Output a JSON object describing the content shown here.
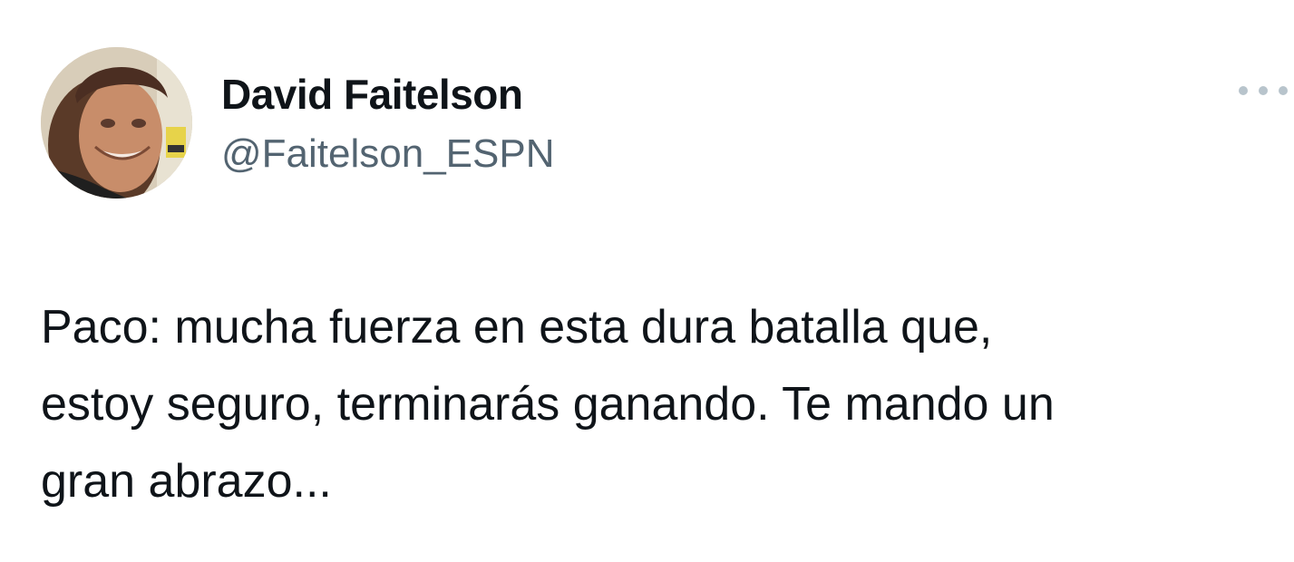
{
  "tweet": {
    "author": {
      "display_name": "David Faitelson",
      "handle": "@Faitelson_ESPN",
      "avatar_icon": "profile-photo"
    },
    "more_icon": "more-options-icon",
    "text_lines": [
      "Paco: mucha fuerza en esta dura batalla que,",
      "estoy seguro, terminarás ganando. Te mando un",
      "gran abrazo..."
    ]
  },
  "colors": {
    "text_primary": "#0f1419",
    "text_secondary": "#536471",
    "more_dots": "#b8c4cc",
    "background": "#ffffff"
  }
}
